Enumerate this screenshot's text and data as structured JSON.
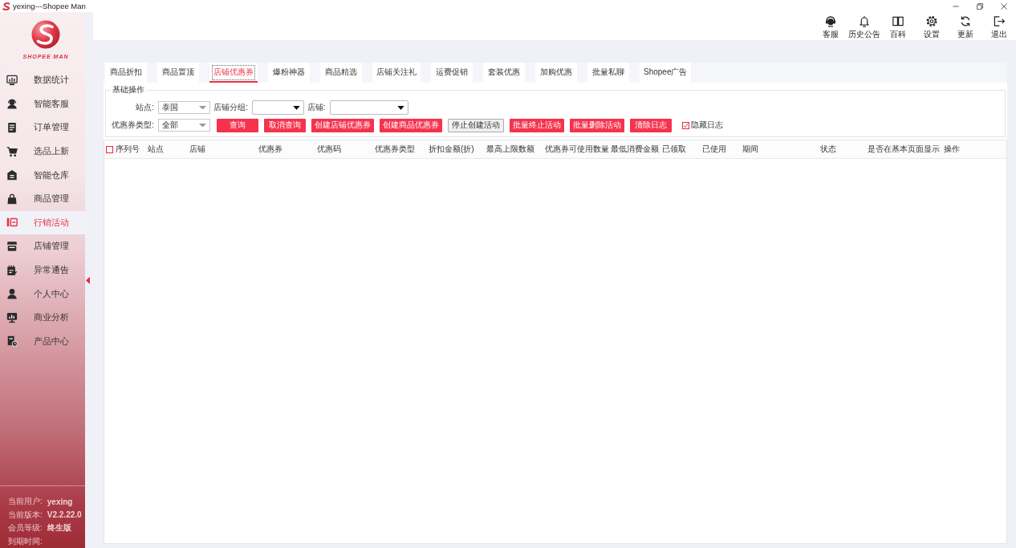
{
  "window": {
    "title": "yexing---Shopee Man"
  },
  "sidebar": {
    "logo_text": "SHOPEE MAN",
    "items": [
      {
        "label": "数据统计",
        "selected": false
      },
      {
        "label": "智能客服",
        "selected": false
      },
      {
        "label": "订单管理",
        "selected": false
      },
      {
        "label": "选品上新",
        "selected": false
      },
      {
        "label": "智能仓库",
        "selected": false
      },
      {
        "label": "商品管理",
        "selected": false
      },
      {
        "label": "行销活动",
        "selected": true
      },
      {
        "label": "店铺管理",
        "selected": false
      },
      {
        "label": "异常通告",
        "selected": false
      },
      {
        "label": "个人中心",
        "selected": false
      },
      {
        "label": "商业分析",
        "selected": false
      },
      {
        "label": "产品中心",
        "selected": false
      }
    ],
    "account": [
      {
        "label": "当前用户:",
        "value": "yexing"
      },
      {
        "label": "当前版本:",
        "value": "V2.2.22.0"
      },
      {
        "label": "会员等级:",
        "value": "终生版"
      },
      {
        "label": "到期时间:"
      }
    ]
  },
  "toolbar": {
    "actions": [
      "客服",
      "历史公告",
      "百科",
      "设置",
      "更新",
      "退出"
    ]
  },
  "tabs": [
    {
      "label": "商品折扣",
      "selected": false
    },
    {
      "label": "商品置顶",
      "selected": false
    },
    {
      "label": "店铺优惠券",
      "selected": true
    },
    {
      "label": "爆粉神器",
      "selected": false
    },
    {
      "label": "商品精选",
      "selected": false
    },
    {
      "label": "店铺关注礼",
      "selected": false
    },
    {
      "label": "运费促销",
      "selected": false
    },
    {
      "label": "套装优惠",
      "selected": false
    },
    {
      "label": "加购优惠",
      "selected": false
    },
    {
      "label": "批量私聊",
      "selected": false
    },
    {
      "label": "Shopee广告",
      "selected": false
    }
  ],
  "filters": {
    "title": "基础操作",
    "rows": [
      {
        "fields": [
          {
            "label": "站点:",
            "value": "泰国",
            "kind": "list"
          },
          {
            "label": "店铺分组:",
            "kind": "combo"
          },
          {
            "label": "店铺:",
            "kind": "combo"
          }
        ]
      },
      {
        "fields": [
          {
            "label": "优惠券类型:",
            "value": "全部",
            "kind": "list"
          }
        ],
        "buttons": [
          {
            "label": "查询",
            "kind": "primary"
          },
          {
            "label": "取消查询",
            "kind": "primary"
          },
          {
            "label": "创建店铺优惠券",
            "kind": "primary"
          },
          {
            "label": "创建商品优惠券",
            "kind": "primary"
          },
          {
            "label": "停止创建活动",
            "kind": "secondary"
          },
          {
            "label": "批量终止活动",
            "kind": "primary"
          },
          {
            "label": "批量删除活动",
            "kind": "primary"
          },
          {
            "label": "清除日志",
            "kind": "primary"
          }
        ],
        "checkbox": {
          "label": "隐藏日志",
          "checked": true
        }
      }
    ]
  },
  "table": {
    "select_all": {
      "checked": false
    },
    "columns": [
      "序列号",
      "站点",
      "店铺",
      "优惠券",
      "优惠码",
      "优惠券类型",
      "折扣金额(折)",
      "最高上限数额",
      "优惠券可使用数量",
      "最低消费金额",
      "已领取",
      "已使用",
      "期间",
      "状态",
      "是否在基本页面显示",
      "操作"
    ]
  }
}
